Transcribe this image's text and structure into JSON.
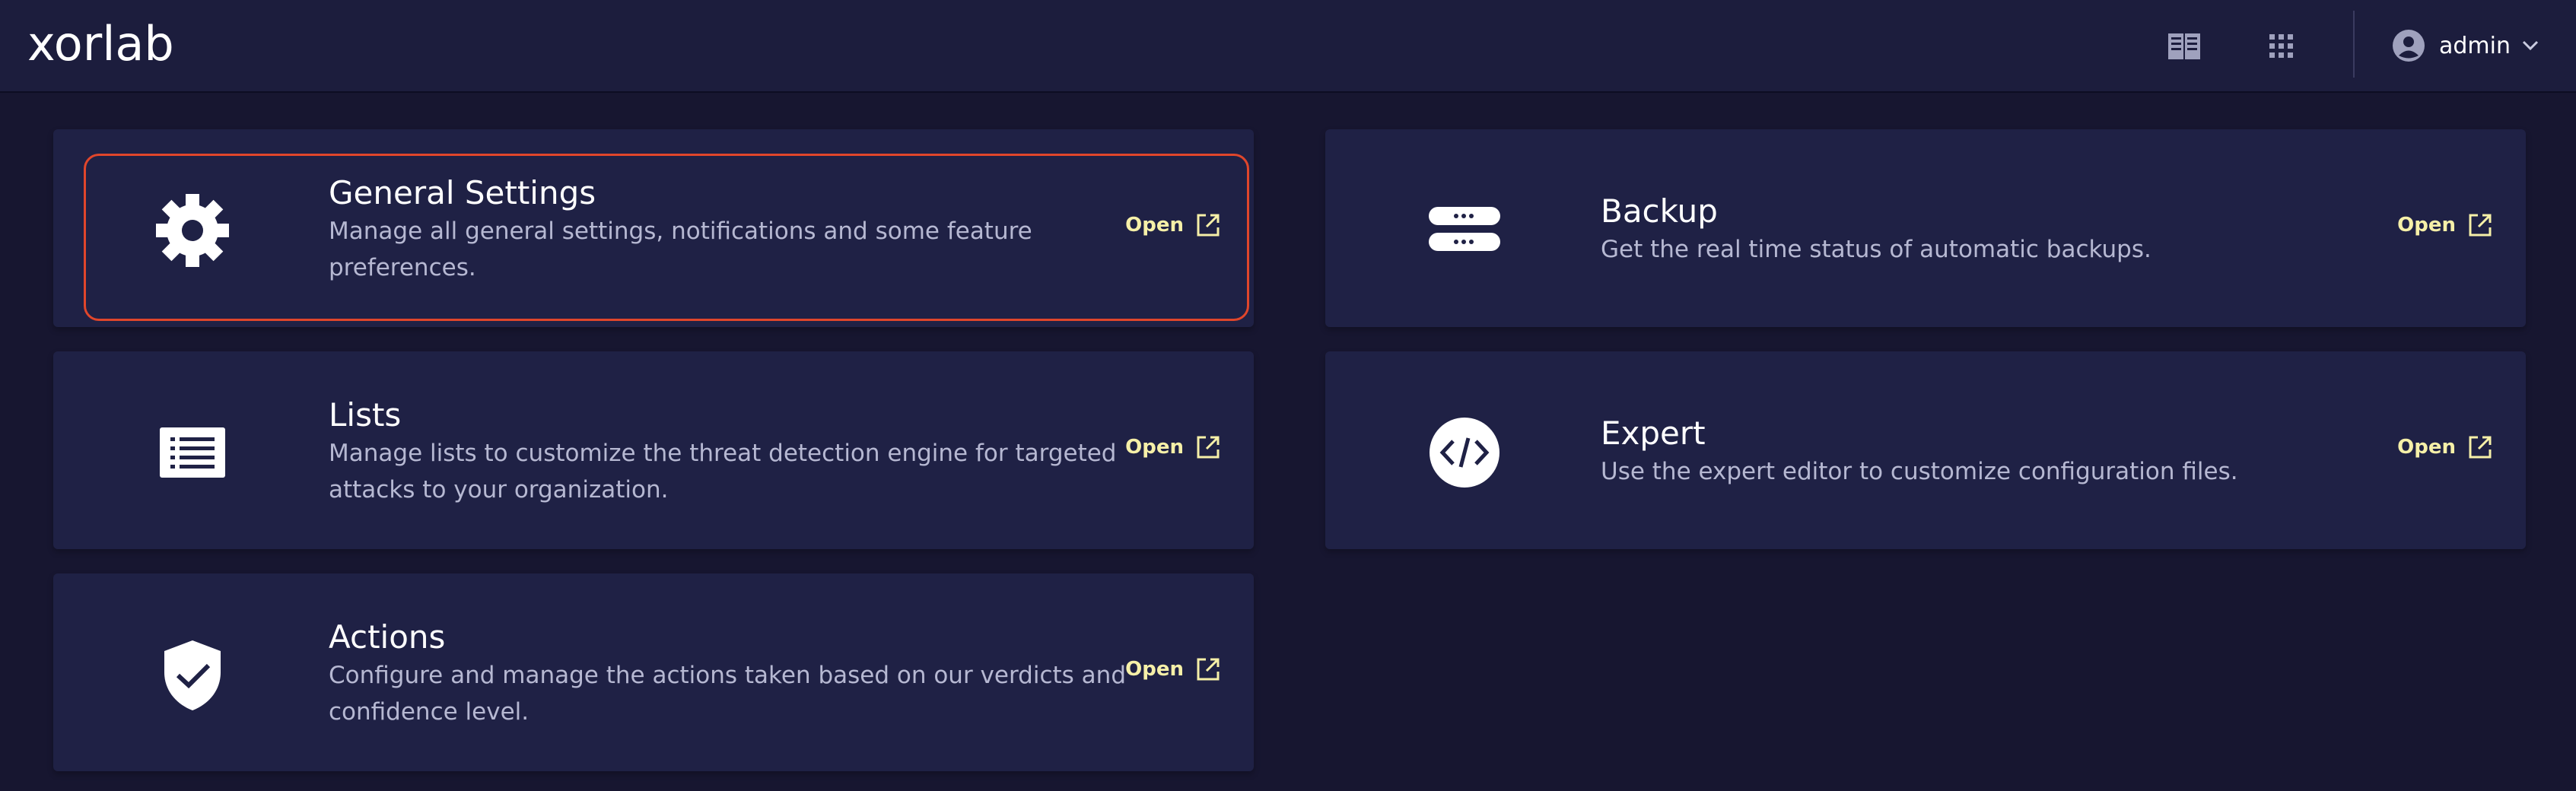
{
  "header": {
    "logo": "xorlab",
    "icons": [
      "book-icon",
      "apps-grid-icon"
    ],
    "user": {
      "name": "admin",
      "icon": "account-circle-icon"
    }
  },
  "cards": [
    {
      "title": "General Settings",
      "description": "Manage all general settings, notifications and some feature preferences.",
      "icon": "gear-icon",
      "open_label": "Open",
      "selected": true
    },
    {
      "title": "Backup",
      "description": "Get the real time status of automatic backups.",
      "icon": "server-icon",
      "open_label": "Open"
    },
    {
      "title": "Lists",
      "description": "Manage lists to customize the threat detection engine for targeted attacks to your organization.",
      "icon": "list-icon",
      "open_label": "Open"
    },
    {
      "title": "Expert",
      "description": "Use the expert editor to customize configuration files.",
      "icon": "code-icon",
      "open_label": "Open"
    },
    {
      "title": "Actions",
      "description": "Configure and manage the actions taken based on our verdicts and confidence level.",
      "icon": "shield-check-icon",
      "open_label": "Open"
    }
  ],
  "colors": {
    "background": "#171630",
    "card": "#1f2145",
    "accent_open": "#f6f0a8",
    "selection_border": "#e0462b",
    "description": "#b6b8d2"
  }
}
